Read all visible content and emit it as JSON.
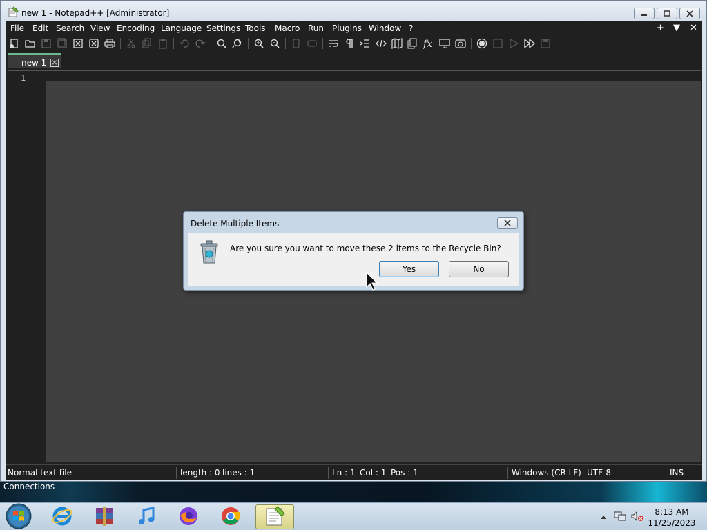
{
  "window": {
    "title": "new 1 - Notepad++ [Administrator]"
  },
  "menu": {
    "items": [
      "File",
      "Edit",
      "Search",
      "View",
      "Encoding",
      "Language",
      "Settings",
      "Tools",
      "Macro",
      "Run",
      "Plugins",
      "Window",
      "?"
    ],
    "right": [
      "+",
      "▼",
      "✕"
    ]
  },
  "toolbar": {
    "buttons": [
      "new-file",
      "open-file",
      "save",
      "save-all",
      "close",
      "close-all",
      "print",
      "cut",
      "copy",
      "paste",
      "undo",
      "redo",
      "find",
      "replace",
      "zoom-in",
      "zoom-out",
      "sync-vertical",
      "sync-horizontal",
      "word-wrap",
      "show-all-chars",
      "indent-guide",
      "xml-tag",
      "document-map",
      "clone",
      "function-list",
      "monitor",
      "camera",
      "record-macro",
      "stop-record",
      "play-macro",
      "run-macro-multiple",
      "save-macro"
    ]
  },
  "tabs": [
    {
      "label": "new 1",
      "active": true
    }
  ],
  "editor": {
    "line_numbers": [
      "1"
    ],
    "content": ""
  },
  "status": {
    "file_type": "Normal text file",
    "length": "length : 0",
    "lines": "lines : 1",
    "ln": "Ln : 1",
    "col": "Col : 1",
    "pos": "Pos : 1",
    "eol": "Windows (CR LF)",
    "encoding": "UTF-8",
    "mode": "INS"
  },
  "dialog": {
    "title": "Delete Multiple Items",
    "message": "Are you sure you want to move these 2 items to the Recycle Bin?",
    "yes_label": "Yes",
    "no_label": "No"
  },
  "desktop": {
    "label": "Connections"
  },
  "taskbar": {
    "apps": [
      "internet-explorer",
      "winrar",
      "itunes",
      "firefox",
      "chrome",
      "notepad-plus-plus"
    ],
    "time": "8:13 AM",
    "date": "11/25/2023"
  },
  "colors": {
    "editor_bg": "#404040",
    "chrome_bg": "#202020",
    "tab_accent": "#6fb98f",
    "dialog_bg": "#f0f0f0"
  }
}
